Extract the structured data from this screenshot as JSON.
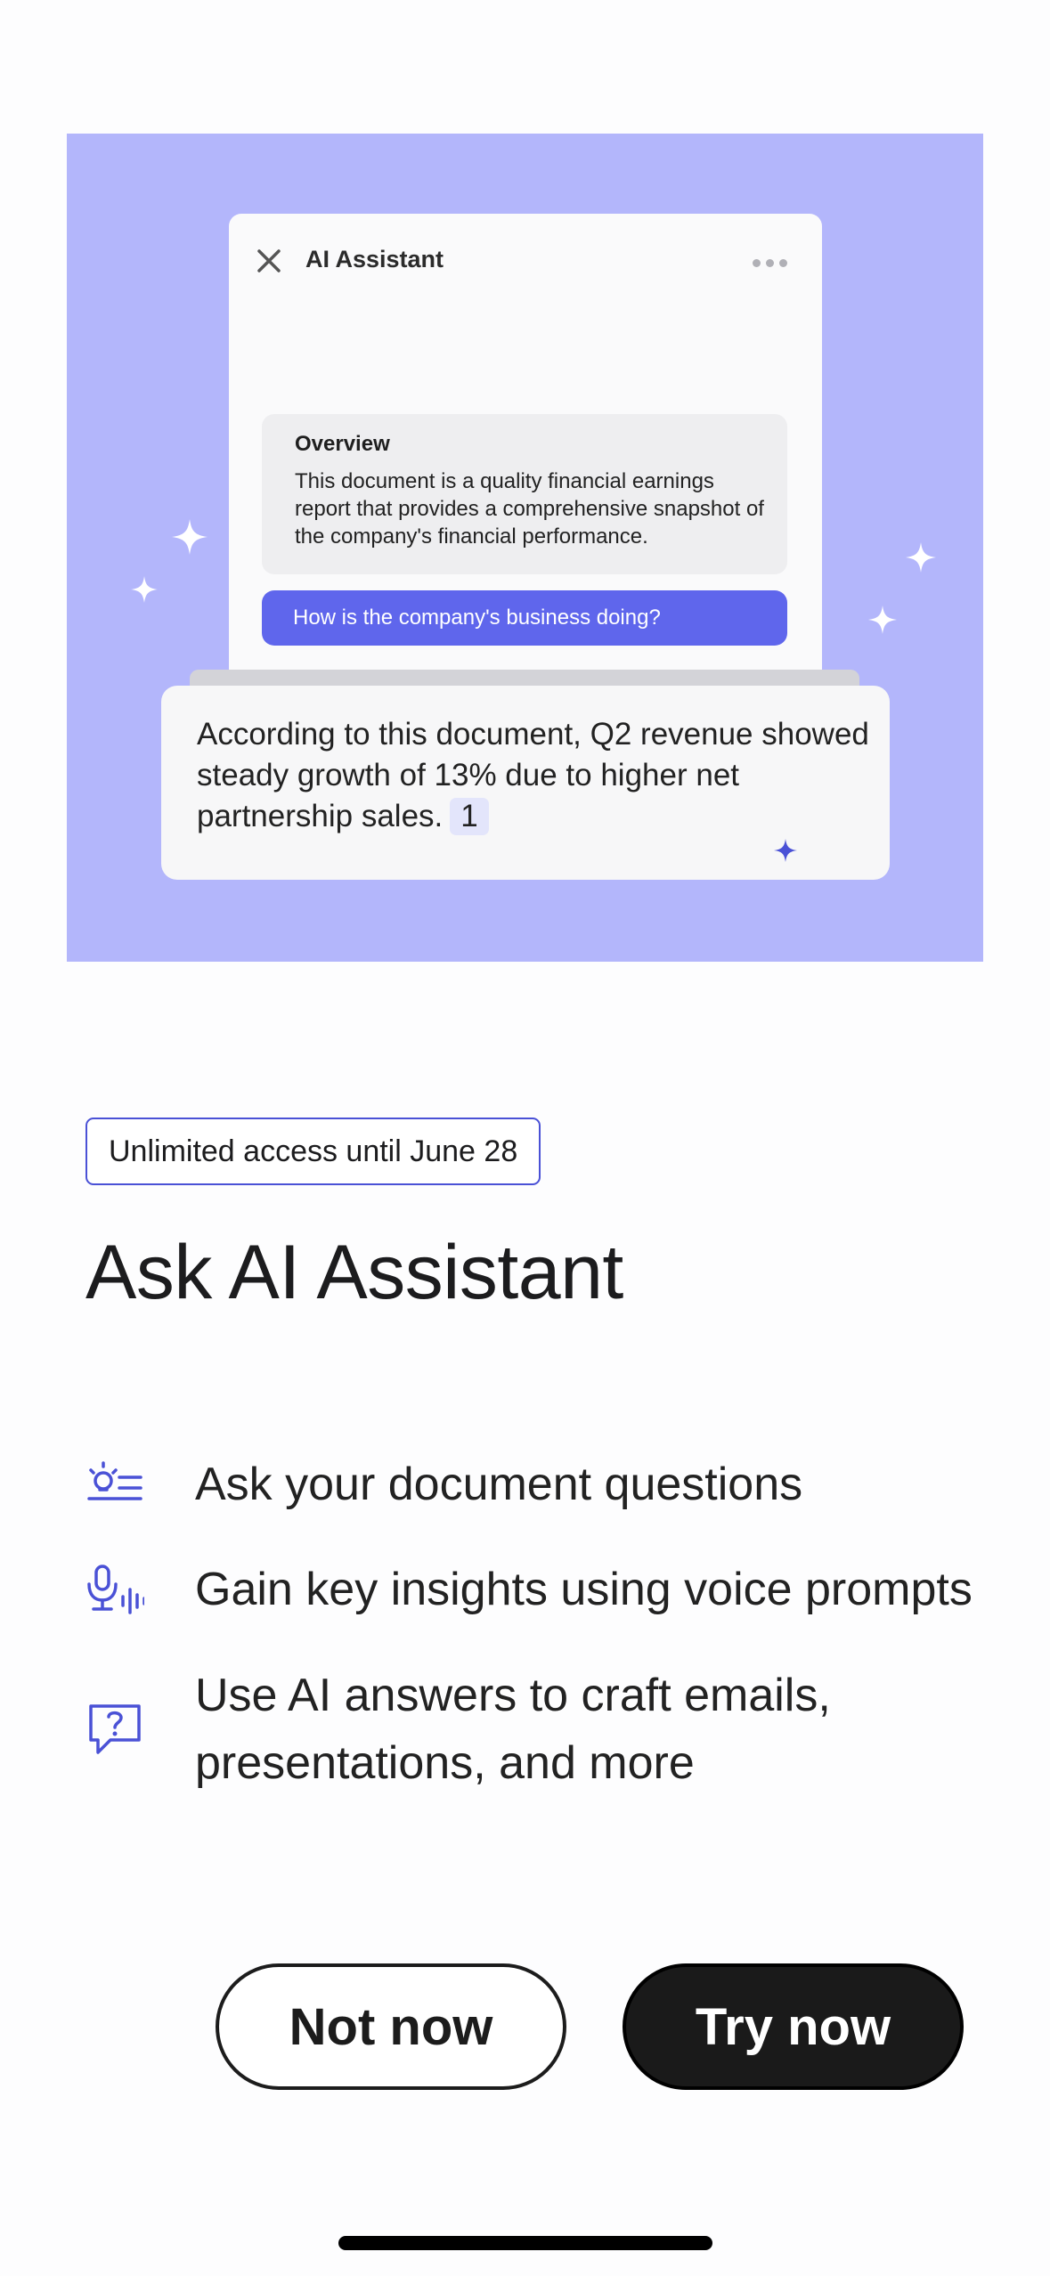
{
  "hero": {
    "panel_title": "AI Assistant",
    "overview_title": "Overview",
    "overview_text": "This document is a quality financial earnings report that provides a comprehensive snapshot of the company's financial performance.",
    "question": "How is the company's business doing?",
    "answer": "According to this document, Q2 revenue showed steady growth of 13% due to higher net partnership sales.",
    "citation": "1",
    "background_color": "#b3b6fb",
    "accent_color": "#5f66ec"
  },
  "badge": "Unlimited access until June 28",
  "title": "Ask AI Assistant",
  "features": [
    {
      "icon": "lightbulb-list-icon",
      "text": "Ask your document questions"
    },
    {
      "icon": "microphone-voice-icon",
      "text": "Gain key insights using voice prompts"
    },
    {
      "icon": "question-bubble-icon",
      "text": "Use AI answers to craft emails, presentations, and more"
    }
  ],
  "buttons": {
    "secondary": "Not now",
    "primary": "Try now"
  }
}
